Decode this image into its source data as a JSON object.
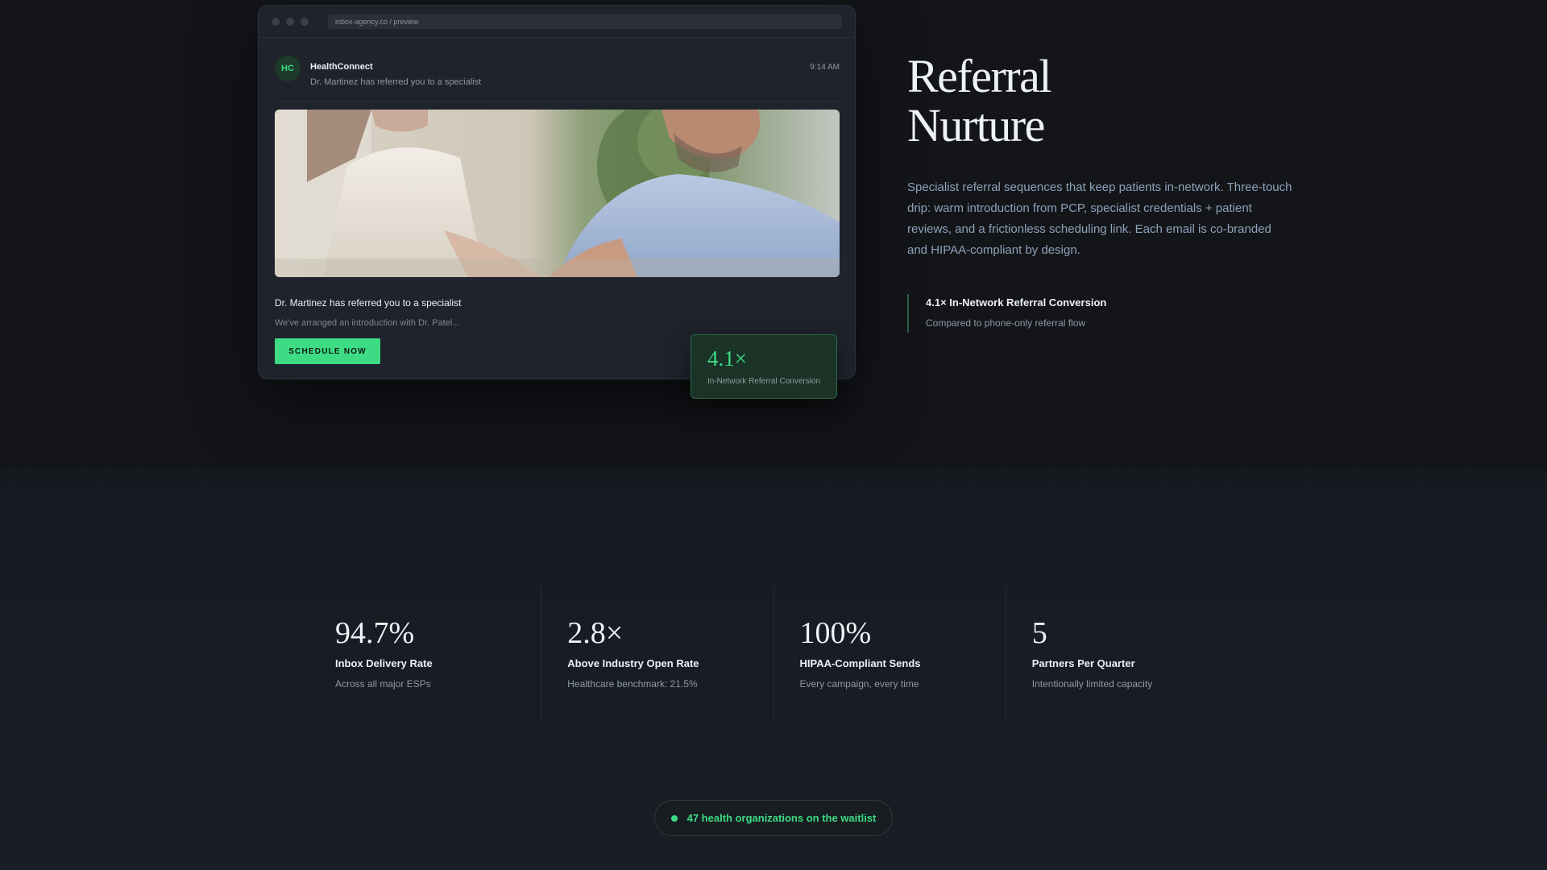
{
  "browser": {
    "url": "inbox-agency.co / preview"
  },
  "email": {
    "avatar_initials": "HC",
    "sender": "HealthConnect",
    "subject": "Dr. Martinez has referred you to a specialist",
    "time": "9:14 AM",
    "title": "Dr. Martinez has referred you to a specialist",
    "preview": "We've arranged an introduction with Dr. Patel...",
    "cta_label": "SCHEDULE NOW"
  },
  "floating_stat": {
    "value": "4.1×",
    "label": "In-Network Referral Conversion"
  },
  "feature": {
    "headline_line1": "Referral",
    "headline_line2": "Nurture",
    "description": "Specialist referral sequences that keep patients in-network. Three-touch drip: warm introduction from PCP, specialist credentials + patient reviews, and a frictionless scheduling link. Each email is co-branded and HIPAA-compliant by design.",
    "callout_title": "4.1× In-Network Referral Conversion",
    "callout_subtitle": "Compared to phone-only referral flow"
  },
  "stats": [
    {
      "value": "94.7%",
      "label": "Inbox Delivery Rate",
      "note": "Across all major ESPs"
    },
    {
      "value": "2.8×",
      "label": "Above Industry Open Rate",
      "note": "Healthcare benchmark: 21.5%"
    },
    {
      "value": "100%",
      "label": "HIPAA-Compliant Sends",
      "note": "Every campaign, every time"
    },
    {
      "value": "5",
      "label": "Partners Per Quarter",
      "note": "Intentionally limited capacity"
    }
  ],
  "waitlist": {
    "text": "47 health organizations on the waitlist"
  },
  "colors": {
    "accent": "#3ddc84",
    "background": "#131519",
    "card": "#1f232b",
    "muted_text": "#8f99a8"
  }
}
